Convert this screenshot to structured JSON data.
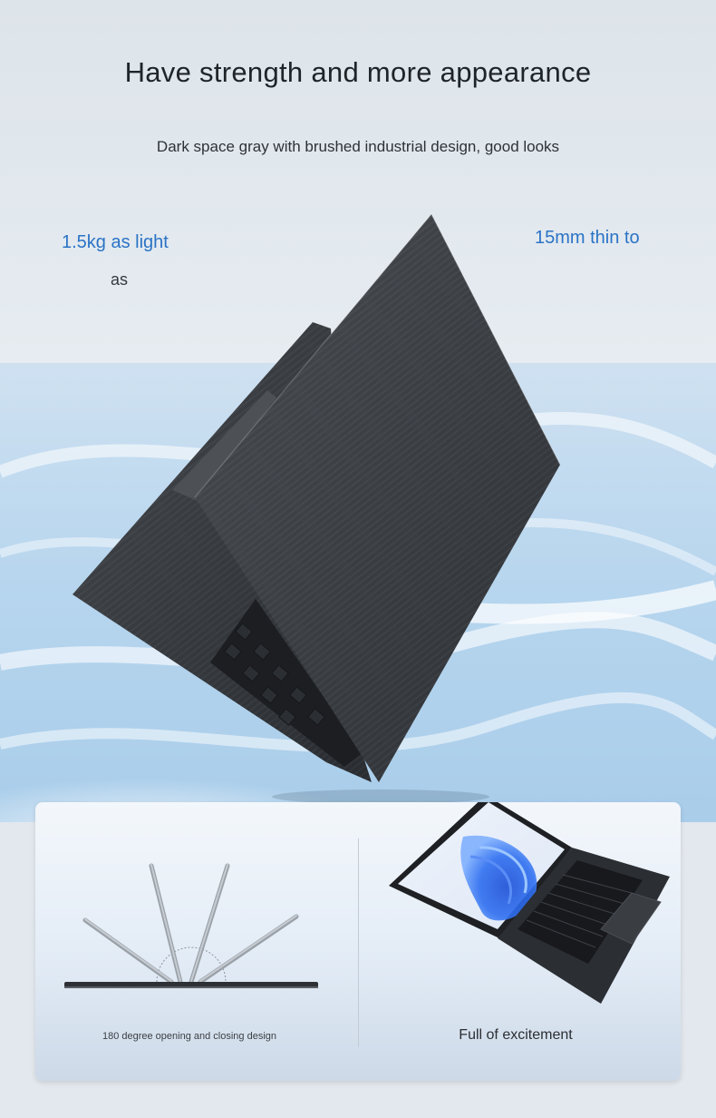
{
  "hero": {
    "headline": "Have strength and more appearance",
    "subhead": "Dark space gray with brushed industrial design, good looks"
  },
  "callouts": {
    "weight_title": "1.5kg as light",
    "weight_sub": "as",
    "thin_title": "15mm thin to"
  },
  "features": {
    "opening_caption": "180 degree opening and closing design",
    "excitement_caption": "Full of excitement"
  },
  "colors": {
    "accent": "#2a73c6",
    "laptop_body": "#3c3f44"
  }
}
